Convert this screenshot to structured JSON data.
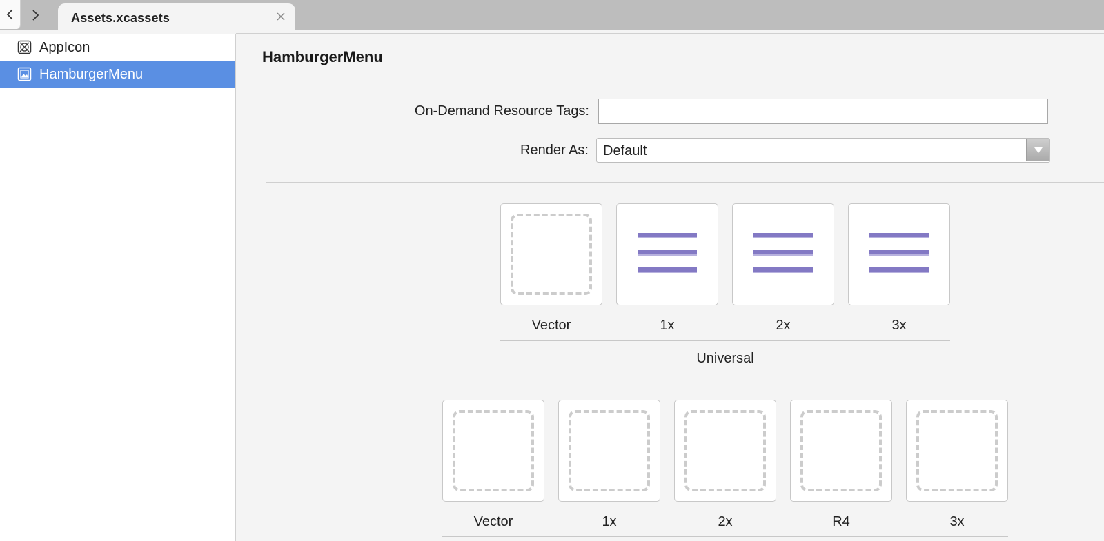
{
  "window": {
    "tab_title": "Assets.xcassets"
  },
  "sidebar": {
    "items": [
      {
        "label": "AppIcon",
        "icon": "appicon-set-icon",
        "selected": false
      },
      {
        "label": "HamburgerMenu",
        "icon": "image-set-icon",
        "selected": true
      }
    ]
  },
  "asset": {
    "title": "HamburgerMenu",
    "tags_label": "On-Demand Resource Tags:",
    "tags_value": "",
    "render_label": "Render As:",
    "render_value": "Default"
  },
  "groups": [
    {
      "label": "Universal",
      "slots": [
        {
          "label": "Vector",
          "filled": false
        },
        {
          "label": "1x",
          "filled": true
        },
        {
          "label": "2x",
          "filled": true
        },
        {
          "label": "3x",
          "filled": true
        }
      ]
    },
    {
      "label": "",
      "slots": [
        {
          "label": "Vector",
          "filled": false
        },
        {
          "label": "1x",
          "filled": false
        },
        {
          "label": "2x",
          "filled": false
        },
        {
          "label": "R4",
          "filled": false
        },
        {
          "label": "3x",
          "filled": false
        }
      ]
    }
  ],
  "colors": {
    "selection": "#5a8fe3",
    "hamburger_bars": "#8379c4",
    "tab_bar": "#bdbdbd"
  }
}
